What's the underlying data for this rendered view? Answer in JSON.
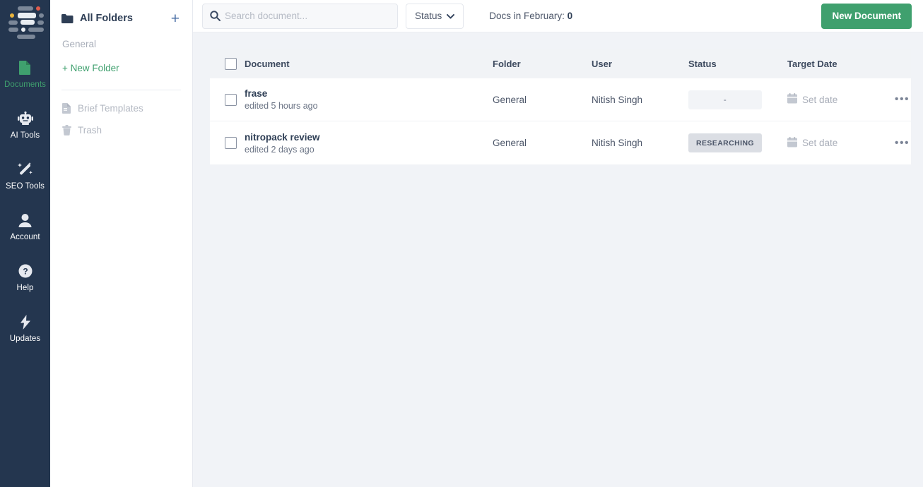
{
  "rail": {
    "logo_name": "frase-logo",
    "items": [
      {
        "label": "Documents",
        "icon": "document-icon",
        "active": true
      },
      {
        "label": "AI Tools",
        "icon": "robot-icon",
        "active": false
      },
      {
        "label": "SEO Tools",
        "icon": "magic-wand-icon",
        "active": false
      },
      {
        "label": "Account",
        "icon": "user-icon",
        "active": false
      },
      {
        "label": "Help",
        "icon": "help-circle-icon",
        "active": false
      },
      {
        "label": "Updates",
        "icon": "lightning-bolt-icon",
        "active": false
      }
    ]
  },
  "folders": {
    "title": "All Folders",
    "add_label": "+",
    "items": [
      {
        "label": "General"
      }
    ],
    "new_folder_label": "+ New Folder",
    "links": [
      {
        "label": "Brief Templates",
        "icon": "file-text-icon"
      },
      {
        "label": "Trash",
        "icon": "trash-icon"
      }
    ]
  },
  "toolbar": {
    "search_placeholder": "Search document...",
    "search_value": "",
    "status_label": "Status",
    "docs_count_label": "Docs in February:",
    "docs_count_value": "0",
    "new_document_label": "New Document",
    "accent_green": "#3fa06e"
  },
  "table": {
    "columns": [
      "Document",
      "Folder",
      "User",
      "Status",
      "Target Date"
    ],
    "rows": [
      {
        "title": "frase",
        "subtitle": "edited 5 hours ago",
        "folder": "General",
        "user": "Nitish Singh",
        "status": "-",
        "status_filled": false,
        "target_date": "Set date"
      },
      {
        "title": "nitropack review",
        "subtitle": "edited 2 days ago",
        "folder": "General",
        "user": "Nitish Singh",
        "status": "RESEARCHING",
        "status_filled": true,
        "target_date": "Set date"
      }
    ],
    "more_glyph": "•••"
  }
}
